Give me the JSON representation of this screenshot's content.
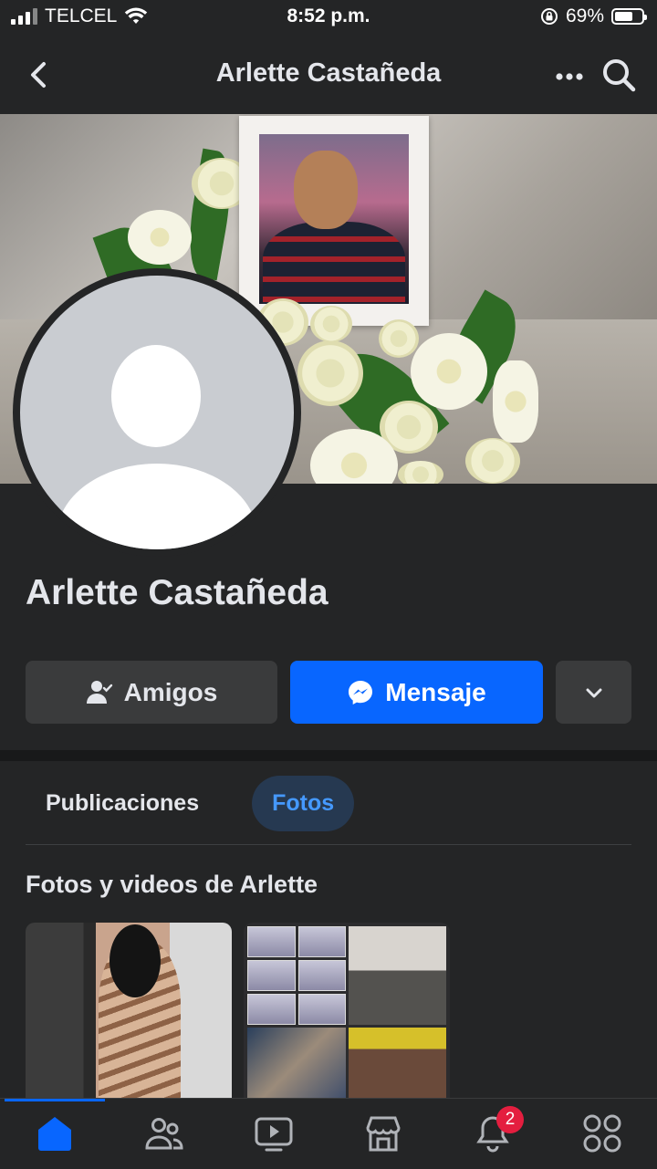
{
  "status_bar": {
    "carrier": "TELCEL",
    "time": "8:52 p.m.",
    "battery": "69%",
    "battery_level": 0.69
  },
  "header": {
    "title": "Arlette Castañeda"
  },
  "profile": {
    "name": "Arlette Castañeda",
    "buttons": {
      "friends_label": "Amigos",
      "message_label": "Mensaje"
    }
  },
  "tabs": [
    {
      "label": "Publicaciones",
      "active": false
    },
    {
      "label": "Fotos",
      "active": true
    }
  ],
  "photos_section": {
    "title": "Fotos y videos de Arlette"
  },
  "bottom_nav": {
    "items": [
      "home-icon",
      "friends-icon",
      "video-icon",
      "marketplace-icon",
      "notifications-icon",
      "menu-icon"
    ],
    "notifications_badge": "2"
  },
  "colors": {
    "background": "#242526",
    "primary_blue": "#0866ff",
    "secondary_button": "#3a3b3c",
    "active_tab_bg": "#263951",
    "active_tab_text": "#4599ff",
    "badge_red": "#e41e3f"
  }
}
